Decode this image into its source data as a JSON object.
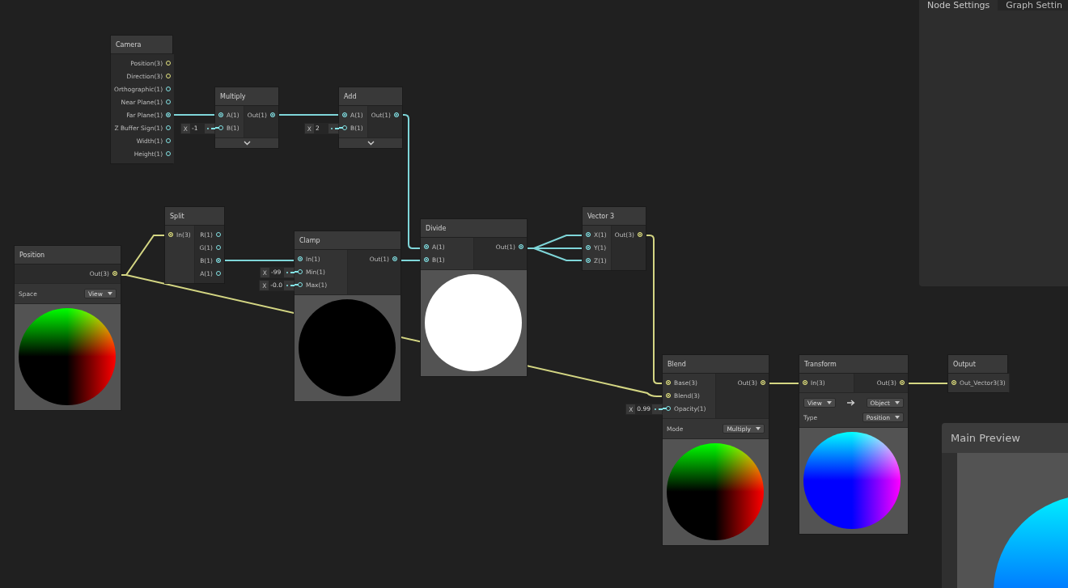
{
  "side_panel": {
    "tabs": [
      {
        "label": "Node Settings",
        "selected": true
      },
      {
        "label": "Graph Settin",
        "selected": false
      }
    ]
  },
  "nodes": [
    {
      "title": "Camera",
      "outputs": [
        {
          "label": "Position(3)",
          "kind": "vector3",
          "connected": false
        },
        {
          "label": "Direction(3)",
          "kind": "vector3",
          "connected": false
        },
        {
          "label": "Orthographic(1)",
          "kind": "float",
          "connected": false
        },
        {
          "label": "Near Plane(1)",
          "kind": "float",
          "connected": false
        },
        {
          "label": "Far Plane(1)",
          "kind": "float",
          "connected": true
        },
        {
          "label": "Z Buffer Sign(1)",
          "kind": "float",
          "connected": false
        },
        {
          "label": "Width(1)",
          "kind": "float",
          "connected": false
        },
        {
          "label": "Height(1)",
          "kind": "float",
          "connected": false
        }
      ]
    },
    {
      "title": "Multiply",
      "inputs": [
        {
          "label": "A(1)",
          "kind": "float",
          "connected": true
        },
        {
          "label": "B(1)",
          "kind": "float",
          "connected": false,
          "default": {
            "axis": "X",
            "value": "-1"
          }
        }
      ],
      "outputs": [
        {
          "label": "Out(1)",
          "kind": "float",
          "connected": true
        }
      ],
      "collapse_toggle": true
    },
    {
      "title": "Add",
      "inputs": [
        {
          "label": "A(1)",
          "kind": "float",
          "connected": true
        },
        {
          "label": "B(1)",
          "kind": "float",
          "connected": false,
          "default": {
            "axis": "X",
            "value": "2"
          }
        }
      ],
      "outputs": [
        {
          "label": "Out(1)",
          "kind": "float",
          "connected": true
        }
      ],
      "collapse_toggle": true
    },
    {
      "title": "Position",
      "outputs": [
        {
          "label": "Out(3)",
          "kind": "vector3",
          "connected": true
        }
      ],
      "settings": [
        {
          "label": "Space",
          "value": "View"
        }
      ],
      "preview": {
        "kind": "xy_gradient"
      }
    },
    {
      "title": "Split",
      "inputs": [
        {
          "label": "In(3)",
          "kind": "vector3",
          "connected": true
        }
      ],
      "outputs": [
        {
          "label": "R(1)",
          "kind": "float",
          "connected": false
        },
        {
          "label": "G(1)",
          "kind": "float",
          "connected": false
        },
        {
          "label": "B(1)",
          "kind": "float",
          "connected": true
        },
        {
          "label": "A(1)",
          "kind": "float",
          "connected": false
        }
      ]
    },
    {
      "title": "Clamp",
      "inputs": [
        {
          "label": "In(1)",
          "kind": "float",
          "connected": true
        },
        {
          "label": "Min(1)",
          "kind": "float",
          "connected": false,
          "default": {
            "axis": "X",
            "value": "-99"
          }
        },
        {
          "label": "Max(1)",
          "kind": "float",
          "connected": false,
          "default": {
            "axis": "X",
            "value": "-0.0"
          }
        }
      ],
      "outputs": [
        {
          "label": "Out(1)",
          "kind": "float",
          "connected": true
        }
      ],
      "preview": {
        "kind": "black"
      }
    },
    {
      "title": "Divide",
      "inputs": [
        {
          "label": "A(1)",
          "kind": "float",
          "connected": true
        },
        {
          "label": "B(1)",
          "kind": "float",
          "connected": true
        }
      ],
      "outputs": [
        {
          "label": "Out(1)",
          "kind": "float",
          "connected": true
        }
      ],
      "preview": {
        "kind": "white"
      }
    },
    {
      "title": "Vector 3",
      "inputs": [
        {
          "label": "X(1)",
          "kind": "float",
          "connected": true
        },
        {
          "label": "Y(1)",
          "kind": "float",
          "connected": true
        },
        {
          "label": "Z(1)",
          "kind": "float",
          "connected": true
        }
      ],
      "outputs": [
        {
          "label": "Out(3)",
          "kind": "vector3",
          "connected": true
        }
      ]
    },
    {
      "title": "Blend",
      "inputs": [
        {
          "label": "Base(3)",
          "kind": "vector3",
          "connected": true
        },
        {
          "label": "Blend(3)",
          "kind": "vector3",
          "connected": true
        },
        {
          "label": "Opacity(1)",
          "kind": "float",
          "connected": false,
          "default": {
            "axis": "X",
            "value": "0.99"
          }
        }
      ],
      "outputs": [
        {
          "label": "Out(3)",
          "kind": "vector3",
          "connected": true
        }
      ],
      "settings": [
        {
          "label": "Mode",
          "value": "Multiply"
        }
      ],
      "preview": {
        "kind": "xy_gradient"
      }
    },
    {
      "title": "Transform",
      "inputs": [
        {
          "label": "In(3)",
          "kind": "vector3",
          "connected": true
        }
      ],
      "outputs": [
        {
          "label": "Out(3)",
          "kind": "vector3",
          "connected": true
        }
      ],
      "conversion": {
        "from": "View",
        "to": "Object"
      },
      "settings": [
        {
          "label": "Type",
          "value": "Position"
        }
      ],
      "preview": {
        "kind": "xyz_gradient"
      }
    },
    {
      "title": "Output",
      "inputs": [
        {
          "label": "Out_Vector3(3)",
          "kind": "vector3",
          "connected": true
        }
      ]
    }
  ],
  "main_preview": {
    "title": "Main Preview"
  }
}
